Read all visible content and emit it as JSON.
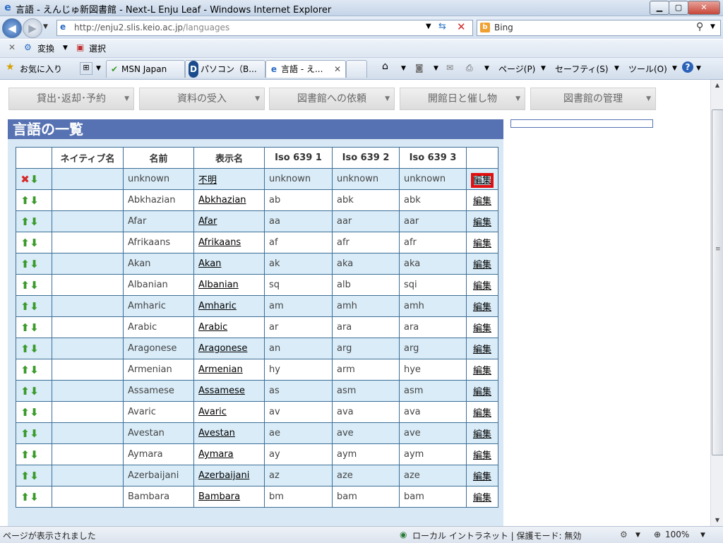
{
  "window": {
    "title": "言語 - えんじゅ新図書館 - Next-L Enju Leaf - Windows Internet Explorer",
    "icon": "ie-icon"
  },
  "address": {
    "url_host": "http://enju2.slis.keio.ac.jp",
    "url_path": "/languages",
    "search_label": "Bing"
  },
  "translate_bar": {
    "convert_label": "変換",
    "select_label": "選択"
  },
  "tabs_bar": {
    "favorites_label": "お気に入り",
    "tabs": [
      {
        "label": "MSN Japan"
      },
      {
        "label": "パソコン（B..."
      },
      {
        "label": "言語 - え..."
      }
    ],
    "commands": {
      "page": "ページ(P)",
      "safety": "セーフティ(S)",
      "tools": "ツール(O)"
    }
  },
  "menu": {
    "items": [
      {
        "label": "貸出･返却･予約"
      },
      {
        "label": "資料の受入"
      },
      {
        "label": "図書館への依頼"
      },
      {
        "label": "開館日と催し物"
      },
      {
        "label": "図書館の管理"
      }
    ]
  },
  "page": {
    "title": "言語の一覧"
  },
  "table": {
    "headers": [
      "",
      "ネイティブ名",
      "名前",
      "表示名",
      "Iso 639 1",
      "Iso 639 2",
      "Iso 639 3",
      ""
    ],
    "edit_label": "編集",
    "rows": [
      {
        "native": "",
        "name": "unknown",
        "display": "不明",
        "iso1": "unknown",
        "iso2": "unknown",
        "iso3": "unknown",
        "first": true
      },
      {
        "native": "",
        "name": "Abkhazian",
        "display": "Abkhazian",
        "iso1": "ab",
        "iso2": "abk",
        "iso3": "abk"
      },
      {
        "native": "",
        "name": "Afar",
        "display": "Afar",
        "iso1": "aa",
        "iso2": "aar",
        "iso3": "aar"
      },
      {
        "native": "",
        "name": "Afrikaans",
        "display": "Afrikaans",
        "iso1": "af",
        "iso2": "afr",
        "iso3": "afr"
      },
      {
        "native": "",
        "name": "Akan",
        "display": "Akan",
        "iso1": "ak",
        "iso2": "aka",
        "iso3": "aka"
      },
      {
        "native": "",
        "name": "Albanian",
        "display": "Albanian",
        "iso1": "sq",
        "iso2": "alb",
        "iso3": "sqi"
      },
      {
        "native": "",
        "name": "Amharic",
        "display": "Amharic",
        "iso1": "am",
        "iso2": "amh",
        "iso3": "amh"
      },
      {
        "native": "",
        "name": "Arabic",
        "display": "Arabic",
        "iso1": "ar",
        "iso2": "ara",
        "iso3": "ara"
      },
      {
        "native": "",
        "name": "Aragonese",
        "display": "Aragonese",
        "iso1": "an",
        "iso2": "arg",
        "iso3": "arg"
      },
      {
        "native": "",
        "name": "Armenian",
        "display": "Armenian",
        "iso1": "hy",
        "iso2": "arm",
        "iso3": "hye"
      },
      {
        "native": "",
        "name": "Assamese",
        "display": "Assamese",
        "iso1": "as",
        "iso2": "asm",
        "iso3": "asm"
      },
      {
        "native": "",
        "name": "Avaric",
        "display": "Avaric",
        "iso1": "av",
        "iso2": "ava",
        "iso3": "ava"
      },
      {
        "native": "",
        "name": "Avestan",
        "display": "Avestan",
        "iso1": "ae",
        "iso2": "ave",
        "iso3": "ave"
      },
      {
        "native": "",
        "name": "Aymara",
        "display": "Aymara",
        "iso1": "ay",
        "iso2": "aym",
        "iso3": "aym"
      },
      {
        "native": "",
        "name": "Azerbaijani",
        "display": "Azerbaijani",
        "iso1": "az",
        "iso2": "aze",
        "iso3": "aze"
      },
      {
        "native": "",
        "name": "Bambara",
        "display": "Bambara",
        "iso1": "bm",
        "iso2": "bam",
        "iso3": "bam"
      }
    ]
  },
  "status": {
    "message": "ページが表示されました",
    "zone": "ローカル イントラネット | 保護モード: 無効",
    "zoom": "100%"
  },
  "colors": {
    "header_bar": "#5672b2",
    "row_alt": "#d9ecf8",
    "table_border": "#3c6f97",
    "highlight": "#e01010"
  }
}
